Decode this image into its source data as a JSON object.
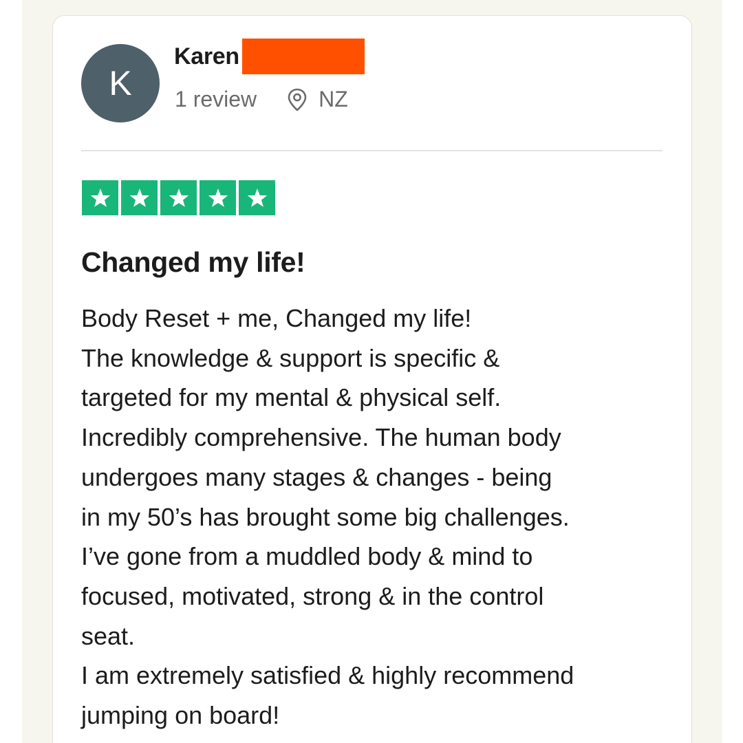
{
  "reviewer": {
    "avatar_initial": "K",
    "name": "Karen",
    "review_count": "1 review",
    "location": "NZ"
  },
  "review": {
    "rating": 5,
    "rating_max": 5,
    "title": "Changed my life!",
    "body_lines": [
      "Body Reset + me, Changed my life!",
      "The knowledge & support is specific &",
      "targeted for my mental & physical self.",
      "Incredibly comprehensive. The human body",
      "undergoes many stages & changes - being",
      "in my 50’s has brought some big challenges.",
      "I’ve gone from a muddled body & mind to",
      "focused, motivated, strong & in the control",
      "seat.",
      "I am extremely satisfied & highly recommend",
      "jumping on board!"
    ]
  },
  "colors": {
    "star_green": "#19b67a",
    "avatar_bg": "#4e6069",
    "redaction": "#ff5000"
  },
  "icons": {
    "location": "location-pin-icon",
    "star": "star-icon"
  }
}
